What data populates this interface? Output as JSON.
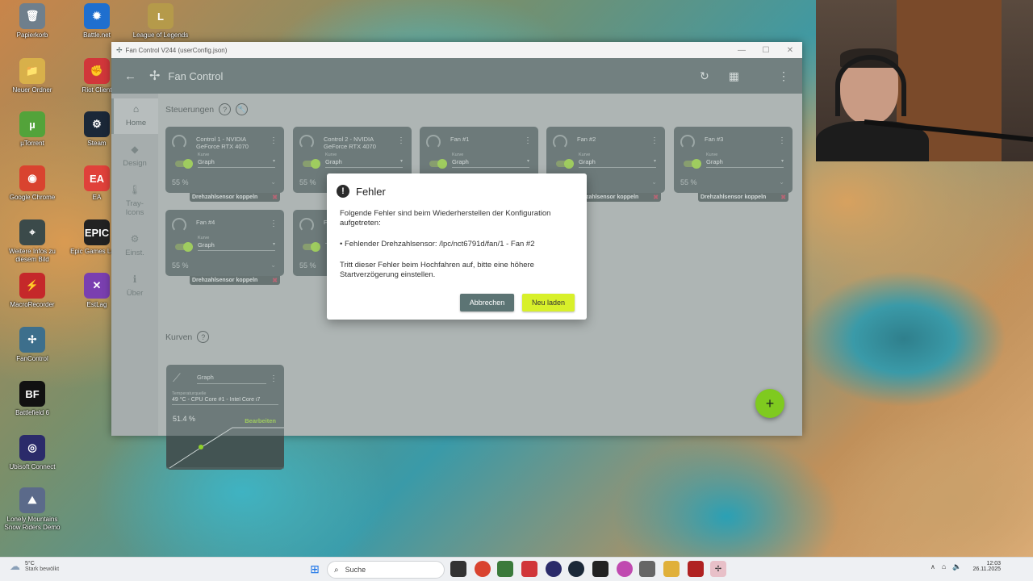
{
  "desktop": {
    "icons_left": [
      {
        "label": "Papierkorb",
        "glyph": "🗑",
        "color": "#6f7f8c"
      },
      {
        "label": "Neuer Ordner",
        "glyph": "📁",
        "color": "#d8b04a"
      },
      {
        "label": "µTorrent",
        "glyph": "µ",
        "color": "#53a33a"
      },
      {
        "label": "Google Chrome",
        "glyph": "◉",
        "color": "#d9432f"
      },
      {
        "label": "Weitere Infos zu diesem Bild",
        "glyph": "⌖",
        "color": "#3b4a4a"
      },
      {
        "label": "MacroRecorder",
        "glyph": "⚡",
        "color": "#c5282a"
      },
      {
        "label": "FanControl",
        "glyph": "✢",
        "color": "#3d6f8c"
      },
      {
        "label": "Battlefield 6",
        "glyph": "BF",
        "color": "#111111"
      },
      {
        "label": "Ubisoft Connect",
        "glyph": "◎",
        "color": "#2b2b6a"
      },
      {
        "label": "Lonely Mountains Snow Riders Demo",
        "glyph": "⛰",
        "color": "#5b6a8a"
      }
    ],
    "icons_right": [
      {
        "label": "Battle.net",
        "glyph": "✹",
        "color": "#1f6fcf"
      },
      {
        "label": "Riot Client",
        "glyph": "✊",
        "color": "#d1363a"
      },
      {
        "label": "Steam",
        "glyph": "⚙",
        "color": "#1b2838"
      },
      {
        "label": "EA",
        "glyph": "EA",
        "color": "#e0413a"
      },
      {
        "label": "Epic Games Lau...",
        "glyph": "EPIC",
        "color": "#222222"
      },
      {
        "label": "EstLag",
        "glyph": "✕",
        "color": "#7a3fb0"
      }
    ],
    "icon_lol": {
      "label": "League of Legends",
      "glyph": "L",
      "color": "#b59a4a"
    }
  },
  "window": {
    "title": "Fan Control V244 (userConfig.json)",
    "app_title": "Fan Control",
    "controls": [
      "—",
      "☐",
      "✕"
    ]
  },
  "sidebar": {
    "items": [
      {
        "label": "Home",
        "glyph": "⌂",
        "active": true
      },
      {
        "label": "Design",
        "glyph": "◆",
        "active": false
      },
      {
        "label": "Tray-\nIcons",
        "glyph": "🌡",
        "active": false
      },
      {
        "label": "Einst.",
        "glyph": "⚙",
        "active": false
      },
      {
        "label": "Über",
        "glyph": "ℹ",
        "active": false
      }
    ]
  },
  "sections": {
    "controls_title": "Steuerungen",
    "curves_title": "Kurven"
  },
  "cards": [
    {
      "name": "Control 1 - NVIDIA GeForce RTX 4070",
      "curve_label": "Kurve",
      "curve": "Graph",
      "percent": "55 %",
      "pair": "Drehzahlsensor koppeln"
    },
    {
      "name": "Control 2 - NVIDIA GeForce RTX 4070",
      "curve_label": "Kurve",
      "curve": "Graph",
      "percent": "55 %",
      "pair": ""
    },
    {
      "name": "Fan #1",
      "curve_label": "Kurve",
      "curve": "Graph",
      "percent": "",
      "pair": ""
    },
    {
      "name": "Fan #2",
      "curve_label": "Kurve",
      "curve": "Graph",
      "percent": "",
      "pair": "Drehzahlsensor koppeln"
    },
    {
      "name": "Fan #3",
      "curve_label": "Kurve",
      "curve": "Graph",
      "percent": "55 %",
      "pair": "Drehzahlsensor koppeln"
    },
    {
      "name": "Fan #4",
      "curve_label": "Kurve",
      "curve": "Graph",
      "percent": "55 %",
      "pair": "Drehzahlsensor koppeln"
    },
    {
      "name": "F",
      "curve_label": "",
      "curve": "",
      "percent": "55 %",
      "pair": ""
    }
  ],
  "curve_card": {
    "name": "Graph",
    "source_label": "Temperaturquelle",
    "source": "49 °C - CPU Core #1 - Intel Core i7",
    "percent": "51.4 %",
    "edit_label": "Bearbeiten"
  },
  "dialog": {
    "title": "Fehler",
    "intro": "Folgende Fehler sind beim Wiederherstellen der Konfiguration aufgetreten:",
    "error_item": "• Fehlender Drehzahlsensor: /lpc/nct6791d/fan/1 - Fan #2",
    "hint": "Tritt dieser Fehler beim Hochfahren auf, bitte eine höhere Startverzögerung einstellen.",
    "cancel_label": "Abbrechen",
    "reload_label": "Neu laden"
  },
  "fab_label": "+",
  "taskbar": {
    "weather_temp": "5°C",
    "weather_text": "Stark bewölkt",
    "search_label": "Suche",
    "time": "12:03",
    "date": "26.11.2025"
  },
  "colors": {
    "accent": "#8fd22a",
    "appbar": "#4a5d5d",
    "card": "#435453",
    "cancel_button": "#5c7474",
    "reload_button": "#d8f02a"
  }
}
